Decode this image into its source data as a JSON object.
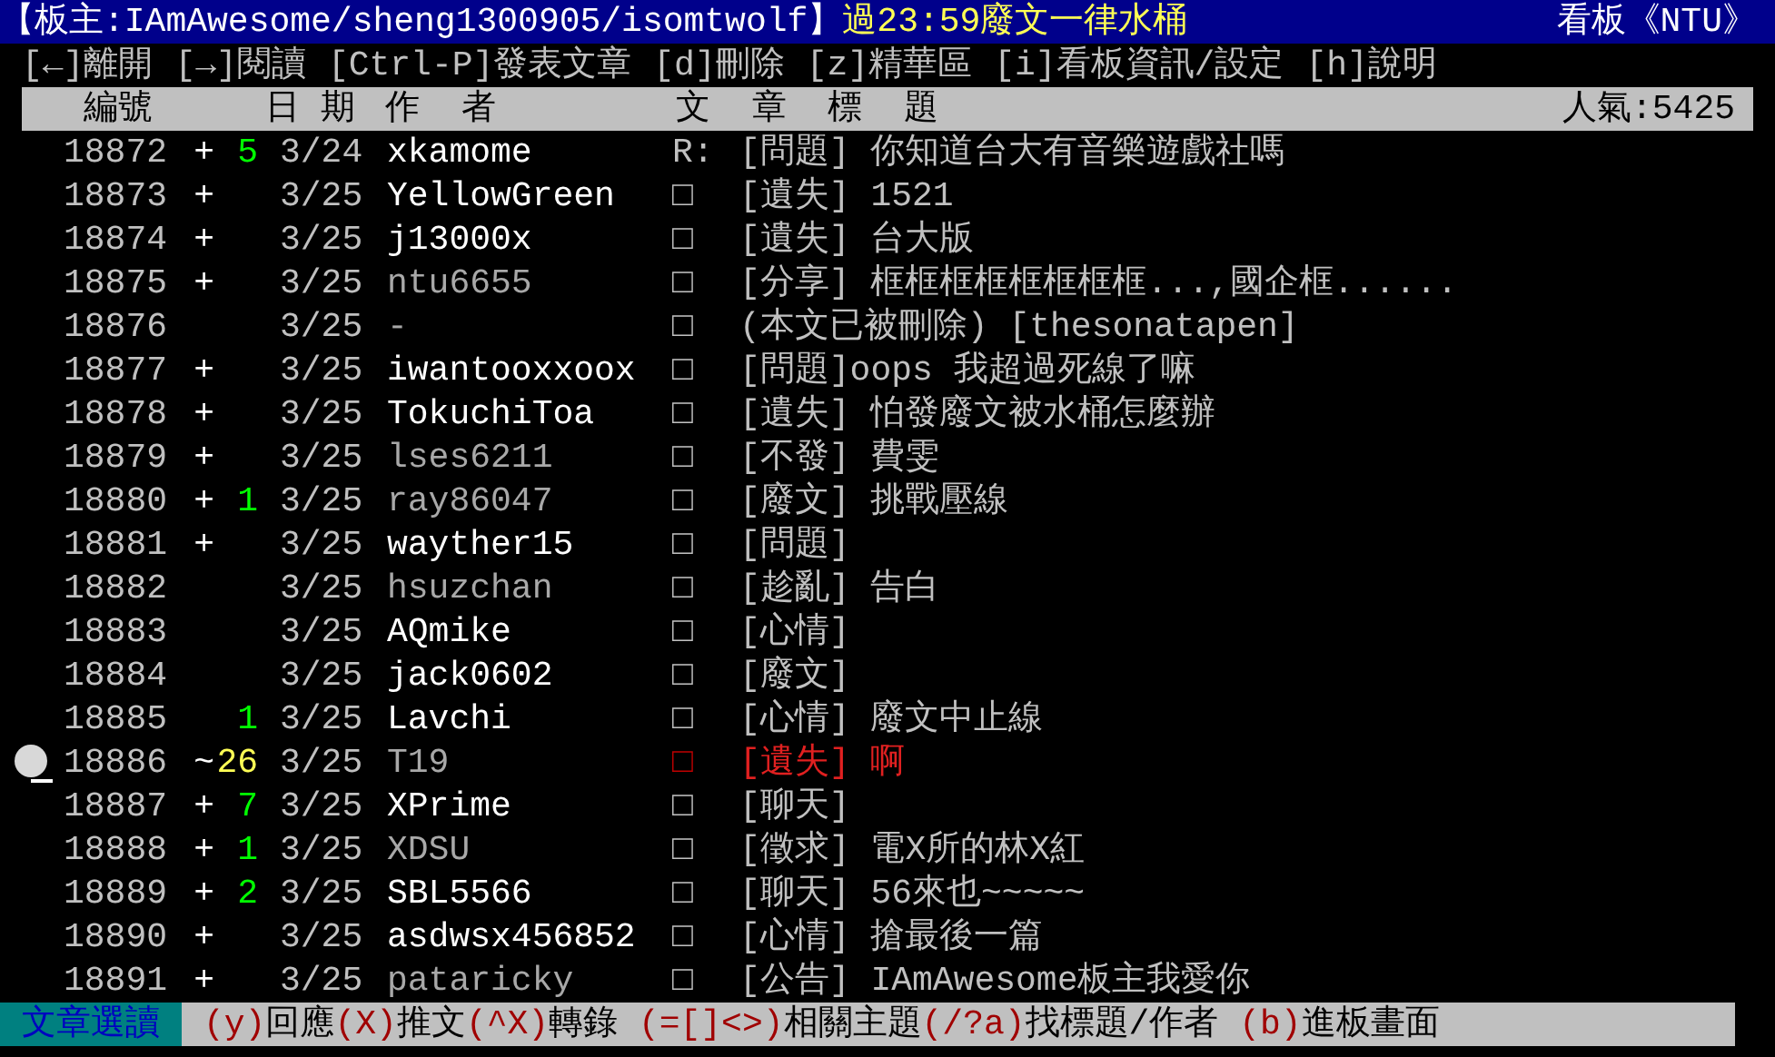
{
  "title_bar": {
    "moderators": "【板主:IAmAwesome/sheng1300905/isomtwolf】",
    "notice": "過23:59廢文一律水桶",
    "board": "看板《NTU》"
  },
  "menu": [
    "[←]離開",
    "[→]閱讀",
    "[Ctrl-P]發表文章",
    "[d]刪除",
    "[z]精華區",
    "[i]看板資訊/設定",
    "[h]說明"
  ],
  "header": {
    "number": "編號",
    "date": "日 期",
    "author": "作  者",
    "title": "文  章  標  題",
    "popularity": "人氣:5425"
  },
  "articles": [
    {
      "number": "18872",
      "status": "+",
      "count": "5",
      "date": "3/24",
      "author": "xkamome",
      "bright": true,
      "mark": "R:",
      "title": "[問題] 你知道台大有音樂遊戲社嗎",
      "selected": false
    },
    {
      "number": "18873",
      "status": "+",
      "date": "3/25",
      "author": "YellowGreen",
      "bright": true,
      "mark": "□",
      "title": "[遺失] 1521",
      "selected": false
    },
    {
      "number": "18874",
      "status": "+",
      "date": "3/25",
      "author": "j13000x",
      "bright": true,
      "mark": "□",
      "title": "[遺失] 台大版",
      "selected": false
    },
    {
      "number": "18875",
      "status": "+",
      "date": "3/25",
      "author": "ntu6655",
      "bright": false,
      "mark": "□",
      "title": "[分享] 框框框框框框框框...,國企框......",
      "selected": false
    },
    {
      "number": "18876",
      "date": "3/25",
      "author": "-",
      "bright": false,
      "mark": "□",
      "title": "(本文已被刪除) [thesonatapen]",
      "selected": false
    },
    {
      "number": "18877",
      "status": "+",
      "date": "3/25",
      "author": "iwantooxxoox",
      "bright": true,
      "mark": "□",
      "title": "[問題]oops 我超過死線了嘛",
      "selected": false
    },
    {
      "number": "18878",
      "status": "+",
      "date": "3/25",
      "author": "TokuchiToa",
      "bright": true,
      "mark": "□",
      "title": "[遺失] 怕發廢文被水桶怎麼辦",
      "selected": false
    },
    {
      "number": "18879",
      "status": "+",
      "date": "3/25",
      "author": "lses6211",
      "bright": false,
      "mark": "□",
      "title": "[不發] 費雯",
      "selected": false
    },
    {
      "number": "18880",
      "status": "+",
      "count": "1",
      "date": "3/25",
      "author": "ray86047",
      "bright": false,
      "mark": "□",
      "title": "[廢文] 挑戰壓線",
      "selected": false
    },
    {
      "number": "18881",
      "status": "+",
      "date": "3/25",
      "author": "wayther15",
      "bright": true,
      "mark": "□",
      "title": "[問題]",
      "selected": false
    },
    {
      "number": "18882",
      "date": "3/25",
      "author": "hsuzchan",
      "bright": false,
      "mark": "□",
      "title": "[趁亂] 告白",
      "selected": false
    },
    {
      "number": "18883",
      "date": "3/25",
      "author": "AQmike",
      "bright": true,
      "mark": "□",
      "title": "[心情]",
      "selected": false
    },
    {
      "number": "18884",
      "date": "3/25",
      "author": "jack0602",
      "bright": true,
      "mark": "□",
      "title": "[廢文]",
      "selected": false
    },
    {
      "number": "18885",
      "count": "1",
      "date": "3/25",
      "author": "Lavchi",
      "bright": true,
      "mark": "□",
      "title": "[心情] 廢文中止線",
      "selected": false
    },
    {
      "number": "18886",
      "status": "~",
      "count": "26",
      "date": "3/25",
      "author": "T19",
      "bright": false,
      "mark": "□",
      "title": "[遺失] 啊",
      "selected": true
    },
    {
      "number": "18887",
      "status": "+",
      "count": "7",
      "date": "3/25",
      "author": "XPrime",
      "bright": true,
      "mark": "□",
      "title": "[聊天]",
      "selected": false
    },
    {
      "number": "18888",
      "status": "+",
      "count": "1",
      "date": "3/25",
      "author": "XDSU",
      "bright": false,
      "mark": "□",
      "title": "[徵求] 電X所的林X紅",
      "selected": false
    },
    {
      "number": "18889",
      "status": "+",
      "count": "2",
      "date": "3/25",
      "author": "SBL5566",
      "bright": true,
      "mark": "□",
      "title": "[聊天] 56來也~~~~~",
      "selected": false
    },
    {
      "number": "18890",
      "status": "+",
      "date": "3/25",
      "author": "asdwsx456852",
      "bright": true,
      "mark": "□",
      "title": "[心情] 搶最後一篇",
      "selected": false
    },
    {
      "number": "18891",
      "status": "+",
      "date": "3/25",
      "author": "pataricky",
      "bright": false,
      "mark": "□",
      "title": "[公告] IAmAwesome板主我愛你",
      "selected": false
    }
  ],
  "footer": {
    "mode": "文章選讀",
    "commands": [
      {
        "key": "(y)",
        "label": "回應"
      },
      {
        "key": "(X)",
        "label": "推文"
      },
      {
        "key": "(^X)",
        "label": "轉錄"
      },
      {
        "key": " (=[]<>)",
        "label": "相關主題"
      },
      {
        "key": "(/?a)",
        "label": "找標題/作者"
      },
      {
        "key": " (b)",
        "label": "進板畫面"
      }
    ]
  }
}
